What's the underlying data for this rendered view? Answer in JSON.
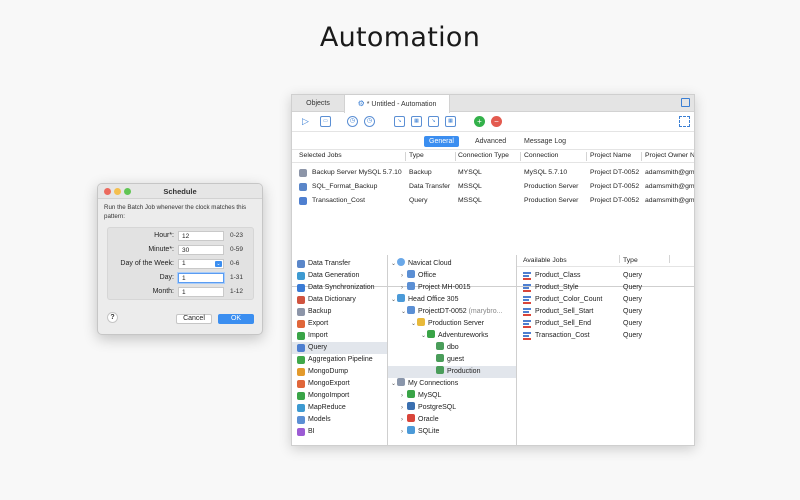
{
  "headline": "Automation",
  "window": {
    "tabs": {
      "objects": "Objects",
      "automation": "* Untitled - Automation"
    },
    "subtabs": [
      "General",
      "Advanced",
      "Message Log"
    ],
    "jobs_columns": [
      "Selected Jobs",
      "Type",
      "Connection Type",
      "Connection",
      "Project Name",
      "Project Owner N"
    ],
    "jobs": [
      {
        "name": "Backup Server MySQL 5.7.10",
        "type": "Backup",
        "conn_type": "MYSQL",
        "connection": "MySQL 5.7.10",
        "project": "Project DT-0052",
        "owner": "adamsmith@gm"
      },
      {
        "name": "SQL_Format_Backup",
        "type": "Data Transfer",
        "conn_type": "MSSQL",
        "connection": "Production Server",
        "project": "Project DT-0052",
        "owner": "adamsmith@gm"
      },
      {
        "name": "Transaction_Cost",
        "type": "Query",
        "conn_type": "MSSQL",
        "connection": "Production Server",
        "project": "Project DT-0052",
        "owner": "adamsmith@gm"
      }
    ],
    "categories": [
      "Data Transfer",
      "Data Generation",
      "Data Synchronization",
      "Data Dictionary",
      "Backup",
      "Export",
      "Import",
      "Query",
      "Aggregation Pipeline",
      "MongoDump",
      "MongoExport",
      "MongoImport",
      "MapReduce",
      "Models",
      "BI"
    ],
    "tree": {
      "navicat_cloud": "Navicat Cloud",
      "office": "Office",
      "project_mh": "Project MH-0015",
      "head_office": "Head Office 305",
      "project_dt": "ProjectDT-0052",
      "project_dt_owner": "(marybro...",
      "production_server": "Production Server",
      "adventureworks": "Adventureworks",
      "dbo": "dbo",
      "guest": "guest",
      "production": "Production",
      "my_connections": "My Connections",
      "mysql": "MySQL",
      "postgresql": "PostgreSQL",
      "oracle": "Oracle",
      "sqlite": "SQLite"
    },
    "available_columns": [
      "Available Jobs",
      "Type"
    ],
    "available_jobs": [
      {
        "name": "Product_Class",
        "type": "Query"
      },
      {
        "name": "Product_Style",
        "type": "Query"
      },
      {
        "name": "Product_Color_Count",
        "type": "Query"
      },
      {
        "name": "Product_Sell_Start",
        "type": "Query"
      },
      {
        "name": "Product_Sell_End",
        "type": "Query"
      },
      {
        "name": "Transaction_Cost",
        "type": "Query"
      }
    ]
  },
  "schedule": {
    "title": "Schedule",
    "description": "Run the Batch Job whenever the clock matches this pattern:",
    "fields": [
      {
        "label": "Hour*:",
        "value": "12",
        "range": "0-23"
      },
      {
        "label": "Minute*:",
        "value": "30",
        "range": "0-59"
      },
      {
        "label": "Day of the Week:",
        "value": "1",
        "range": "0-6"
      },
      {
        "label": "Day:",
        "value": "1",
        "range": "1-31"
      },
      {
        "label": "Month:",
        "value": "1",
        "range": "1-12"
      }
    ],
    "help": "?",
    "cancel": "Cancel",
    "ok": "OK"
  },
  "colors": {
    "accent": "#3b8ef0",
    "selection": "#e2e6ec"
  }
}
